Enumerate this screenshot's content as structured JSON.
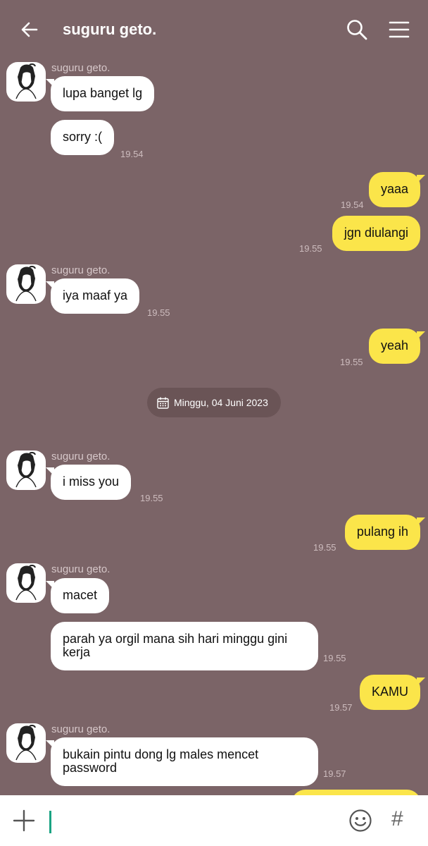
{
  "header": {
    "title": "suguru geto.",
    "back_icon": "arrow-left-icon",
    "search_icon": "search-icon",
    "menu_icon": "hamburger-menu-icon"
  },
  "colors": {
    "background": "#7b6467",
    "incoming_bubble": "#ffffff",
    "outgoing_bubble": "#fbe54a",
    "caret": "#1aa383"
  },
  "messages": [
    {
      "sender": "suguru geto.",
      "text": "lupa banget lg",
      "time": ""
    },
    {
      "text": "sorry :(",
      "time": "19.54"
    },
    {
      "text": "yaaa",
      "time": "19.54"
    },
    {
      "text": "jgn diulangi",
      "time": "19.55"
    },
    {
      "sender": "suguru geto.",
      "text": "iya maaf ya",
      "time": "19.55"
    },
    {
      "text": "yeah",
      "time": "19.55"
    },
    {
      "sender": "suguru geto.",
      "text": "i miss you",
      "time": "19.55"
    },
    {
      "text": "pulang ih",
      "time": "19.55"
    },
    {
      "sender": "suguru geto.",
      "text": "macet",
      "time": ""
    },
    {
      "text": "parah ya orgil mana sih hari minggu gini\nkerja",
      "time": "19.55"
    },
    {
      "text": "KAMU",
      "time": "19.57"
    },
    {
      "sender": "suguru geto.",
      "text": "bukain pintu dong lg males mencet\npassword",
      "time": "19.57"
    }
  ],
  "date_separator": {
    "label": "Minggu, 04 Juni 2023",
    "icon": "calendar-icon"
  },
  "composer": {
    "placeholder": "",
    "plus_icon": "plus-icon",
    "emoji_icon": "emoji-icon",
    "hashtag": "#"
  }
}
